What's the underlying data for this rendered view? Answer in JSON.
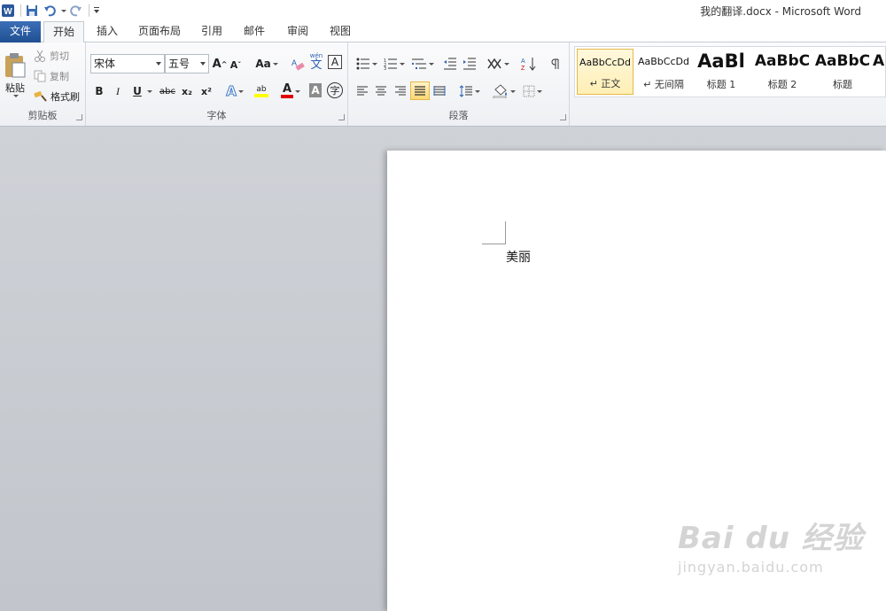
{
  "window": {
    "title": "我的翻译.docx - Microsoft Word"
  },
  "tabs": [
    "文件",
    "开始",
    "插入",
    "页面布局",
    "引用",
    "邮件",
    "审阅",
    "视图"
  ],
  "clipboard": {
    "paste": "粘贴",
    "cut": "剪切",
    "copy": "复制",
    "format_painter": "格式刷",
    "label": "剪贴板"
  },
  "font": {
    "family": "宋体",
    "size": "五号",
    "grow": "A",
    "shrink": "A",
    "change_case": "Aa",
    "bold": "B",
    "italic": "I",
    "underline": "U",
    "strike": "abc",
    "subscript": "x₂",
    "superscript": "x²",
    "text_effects": "A",
    "highlight": "ab",
    "font_color": "A",
    "char_shading": "A",
    "enclose": "字",
    "phonetic": "wén",
    "label": "字体"
  },
  "paragraph": {
    "label": "段落"
  },
  "styles": [
    {
      "sample": "AaBbCcDd",
      "name": "↵ 正文"
    },
    {
      "sample": "AaBbCcDd",
      "name": "↵ 无间隔"
    },
    {
      "sample": "AaBl",
      "name": "标题 1"
    },
    {
      "sample": "AaBbC",
      "name": "标题 2"
    },
    {
      "sample": "AaBbC",
      "name": "标题"
    },
    {
      "sample": "A",
      "name": ""
    }
  ],
  "document": {
    "text": "美丽"
  },
  "watermark": {
    "logo": "Bai du 经验",
    "url": "jingyan.baidu.com"
  },
  "colors": {
    "file_tab": "#2b579a",
    "highlight": "#ffff00",
    "font_color": "#e00000",
    "selected_style": "#e5b84a"
  }
}
